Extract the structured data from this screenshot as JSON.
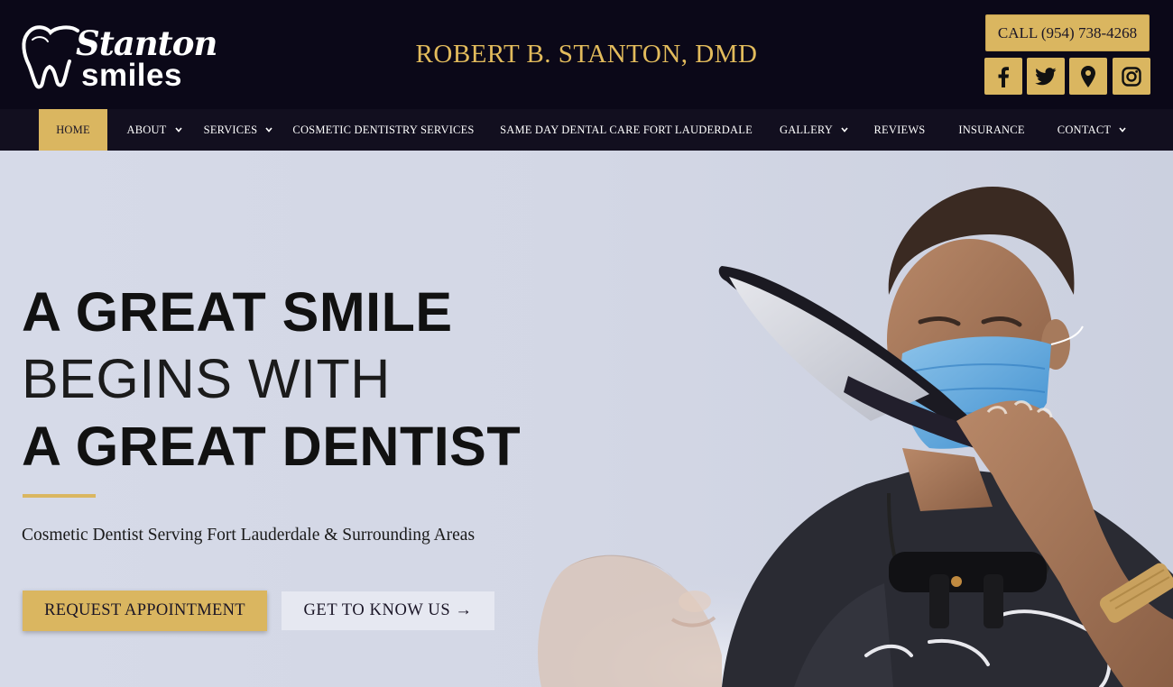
{
  "header": {
    "logo_script": "Stanton",
    "logo_bold": "smiles",
    "doctor_name": "ROBERT B. STANTON, DMD",
    "call_label": "CALL (954) 738-4268",
    "social": [
      "facebook-icon",
      "twitter-icon",
      "map-pin-icon",
      "instagram-icon"
    ]
  },
  "nav": {
    "items": [
      {
        "label": "HOME"
      },
      {
        "label": "ABOUT"
      },
      {
        "label": "SERVICES"
      },
      {
        "label": "COSMETIC DENTISTRY SERVICES"
      },
      {
        "label": "SAME DAY DENTAL CARE FORT LAUDERDALE"
      },
      {
        "label": "GALLERY"
      },
      {
        "label": "REVIEWS"
      },
      {
        "label": "INSURANCE"
      },
      {
        "label": "CONTACT"
      }
    ],
    "active": "HOME"
  },
  "hero": {
    "line1": "A GREAT SMILE",
    "line2": "BEGINS WITH",
    "line3": "A GREAT DENTIST",
    "subheading": "Cosmetic Dentist Serving Fort Lauderdale & Surrounding Areas",
    "primary_button": "REQUEST APPOINTMENT",
    "secondary_button": "GET TO KNOW US →"
  },
  "colors": {
    "header_bg": "#0b0818",
    "nav_bg": "#120f1f",
    "gold": "#dab660",
    "hero_bg": "#d4d8e6"
  }
}
